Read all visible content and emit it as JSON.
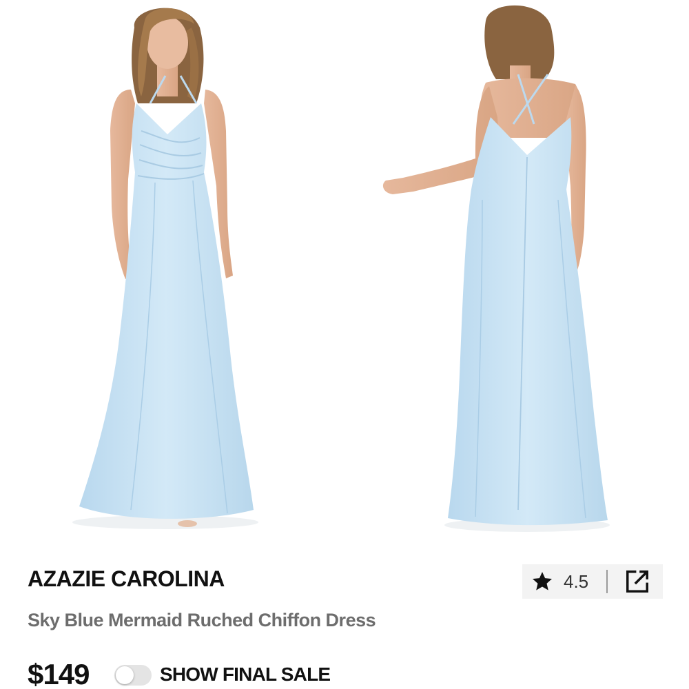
{
  "product": {
    "brand": "AZAZIE CAROLINA",
    "name": "Sky Blue Mermaid Ruched Chiffon Dress",
    "price": "$149",
    "rating": "4.5"
  },
  "filters": {
    "final_sale_label": "SHOW FINAL SALE",
    "final_sale_enabled": false
  },
  "icons": {
    "rating": "star-icon",
    "share": "share-external-icon"
  },
  "colors": {
    "dress": "#c9e3f3",
    "brand_text": "#111111",
    "name_text": "#6d6d6d",
    "rating_bg": "#f3f3f3"
  }
}
